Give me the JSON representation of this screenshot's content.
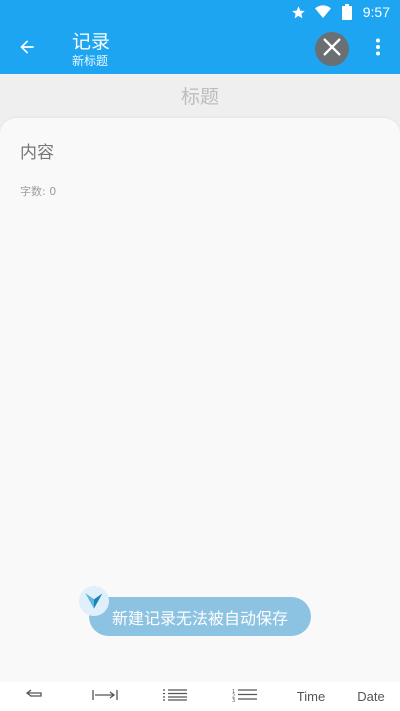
{
  "status_bar": {
    "time": "9:57"
  },
  "app_bar": {
    "title": "记录",
    "subtitle": "新标题"
  },
  "editor": {
    "title_placeholder": "标题",
    "content_placeholder": "内容",
    "word_count": "字数: 0"
  },
  "toast": {
    "message": "新建记录无法被自动保存"
  },
  "toolbar": {
    "time_label": "Time",
    "date_label": "Date"
  },
  "colors": {
    "accent": "#1ea5f2",
    "toast": "#8dc3e2",
    "close_button": "#6a6f73"
  }
}
